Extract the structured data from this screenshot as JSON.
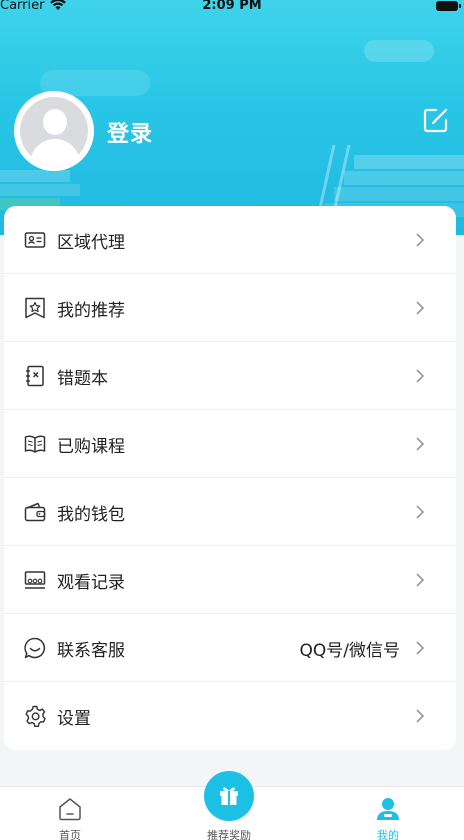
{
  "status_bar": {
    "carrier": "Carrier",
    "time": "2:09 PM"
  },
  "profile": {
    "login_label": "登录"
  },
  "menu": [
    {
      "label": "区域代理",
      "value": "",
      "icon": "id-card-icon"
    },
    {
      "label": "我的推荐",
      "value": "",
      "icon": "star-badge-icon"
    },
    {
      "label": "错题本",
      "value": "",
      "icon": "notebook-icon"
    },
    {
      "label": "已购课程",
      "value": "",
      "icon": "open-book-icon"
    },
    {
      "label": "我的钱包",
      "value": "",
      "icon": "wallet-icon"
    },
    {
      "label": "观看记录",
      "value": "",
      "icon": "history-icon"
    },
    {
      "label": "联系客服",
      "value": "QQ号/微信号",
      "icon": "chat-icon"
    },
    {
      "label": "设置",
      "value": "",
      "icon": "gear-icon"
    }
  ],
  "tabbar": {
    "home": "首页",
    "reward": "推荐奖励",
    "mine": "我的"
  },
  "colors": {
    "accent": "#1cc0e4",
    "header_top": "#3fd3ea",
    "header_bottom": "#21b8e0"
  }
}
